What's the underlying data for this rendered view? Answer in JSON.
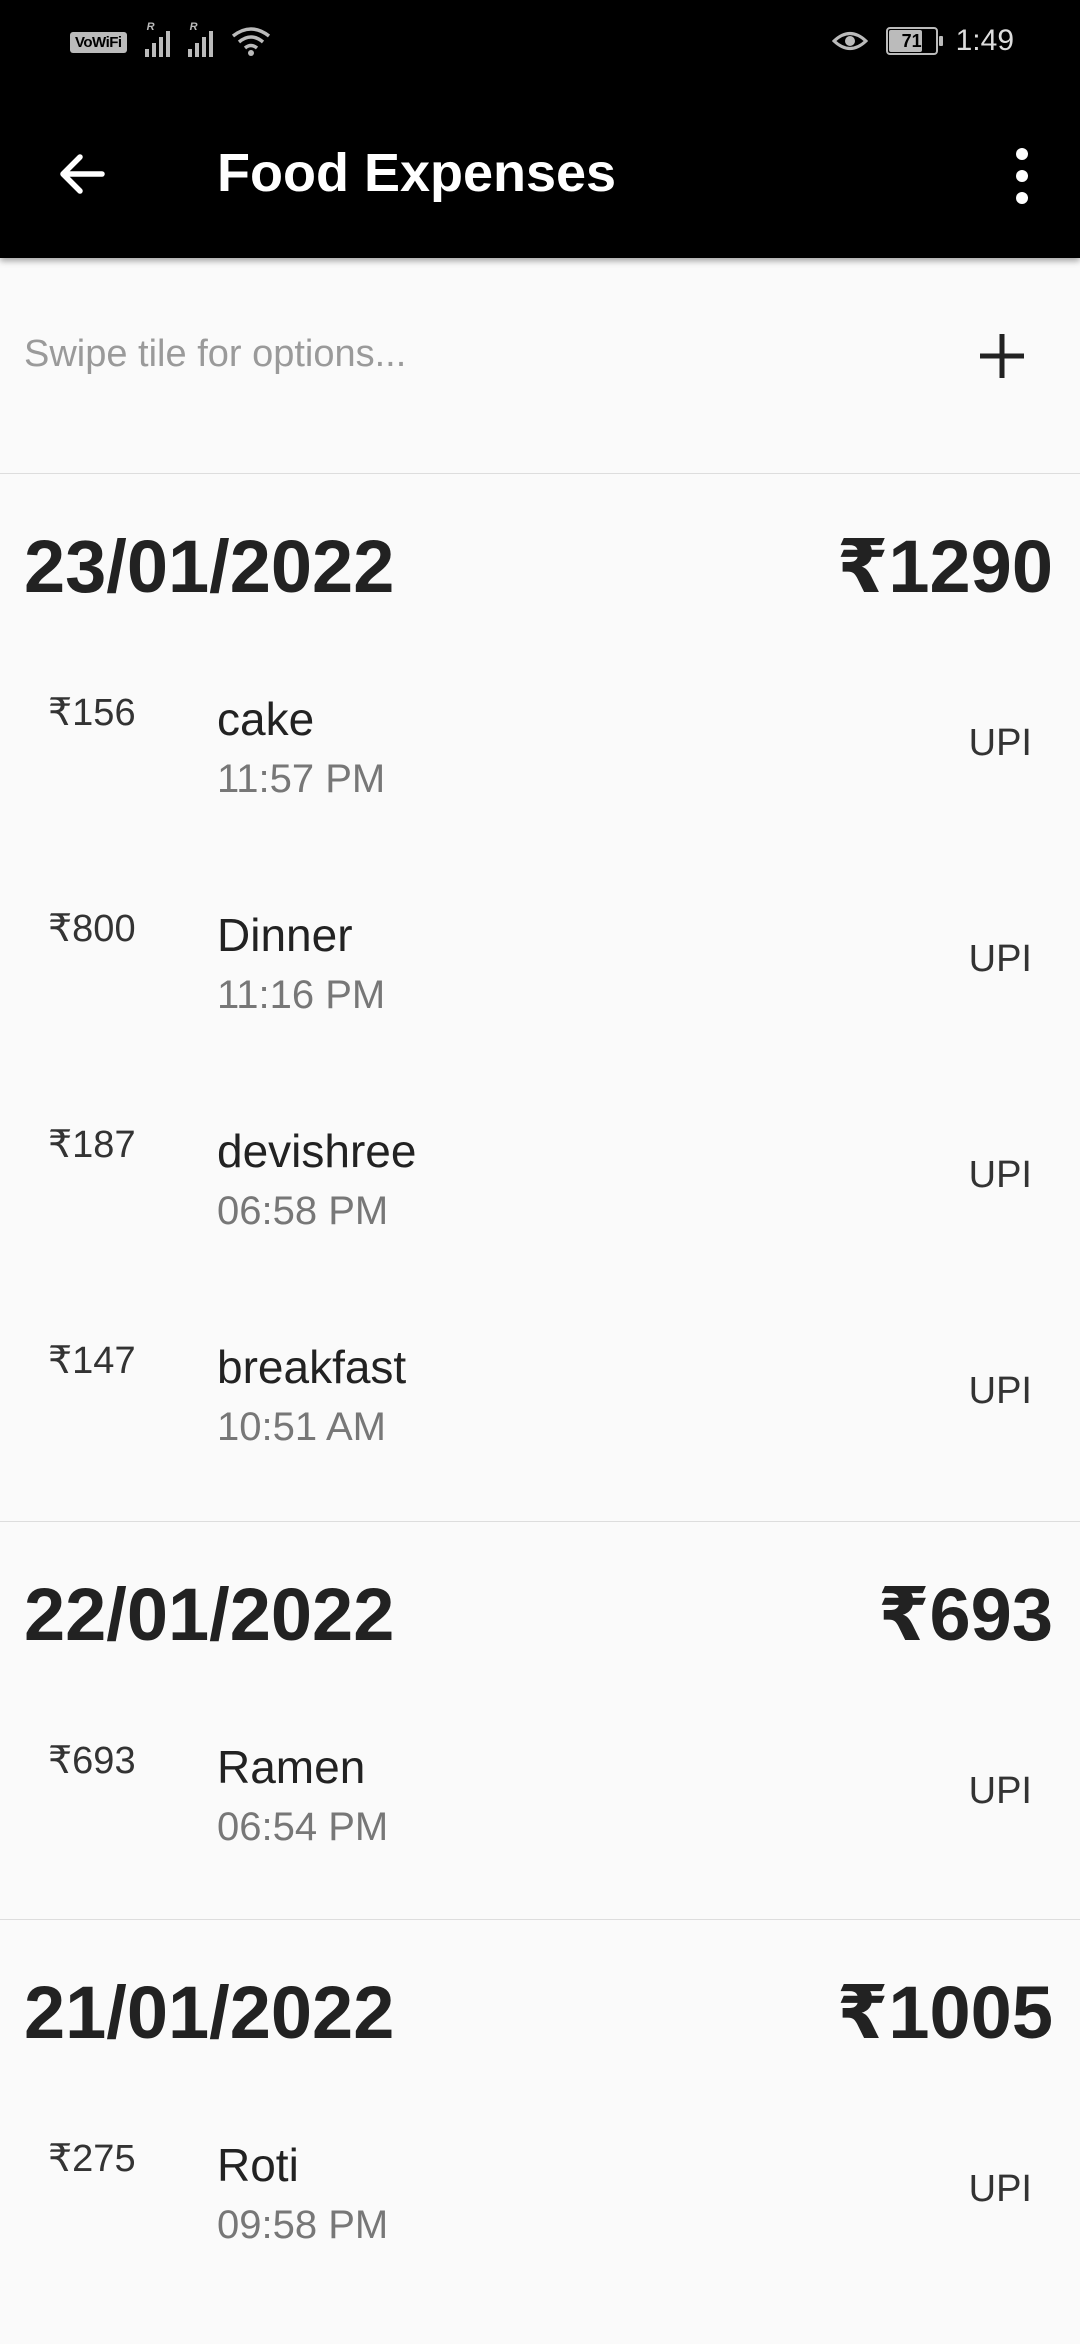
{
  "status_bar": {
    "carrier_badge": "VoWiFi",
    "signal_label_1": "R",
    "signal_label_2": "R",
    "battery": "71",
    "time": "1:49"
  },
  "app_bar": {
    "title": "Food Expenses"
  },
  "hint": {
    "text": "Swipe tile for options..."
  },
  "groups": [
    {
      "date": "23/01/2022",
      "total": "₹1290",
      "items": [
        {
          "amount": "₹156",
          "name": "cake",
          "time": "11:57 PM",
          "mode": "UPI"
        },
        {
          "amount": "₹800",
          "name": "Dinner",
          "time": "11:16 PM",
          "mode": "UPI"
        },
        {
          "amount": "₹187",
          "name": "devishree",
          "time": "06:58 PM",
          "mode": "UPI"
        },
        {
          "amount": "₹147",
          "name": "breakfast",
          "time": "10:51 AM",
          "mode": "UPI"
        }
      ]
    },
    {
      "date": "22/01/2022",
      "total": "₹693",
      "items": [
        {
          "amount": "₹693",
          "name": "Ramen",
          "time": "06:54 PM",
          "mode": "UPI"
        }
      ]
    },
    {
      "date": "21/01/2022",
      "total": "₹1005",
      "items": [
        {
          "amount": "₹275",
          "name": "Roti",
          "time": "09:58 PM",
          "mode": "UPI"
        }
      ]
    }
  ]
}
